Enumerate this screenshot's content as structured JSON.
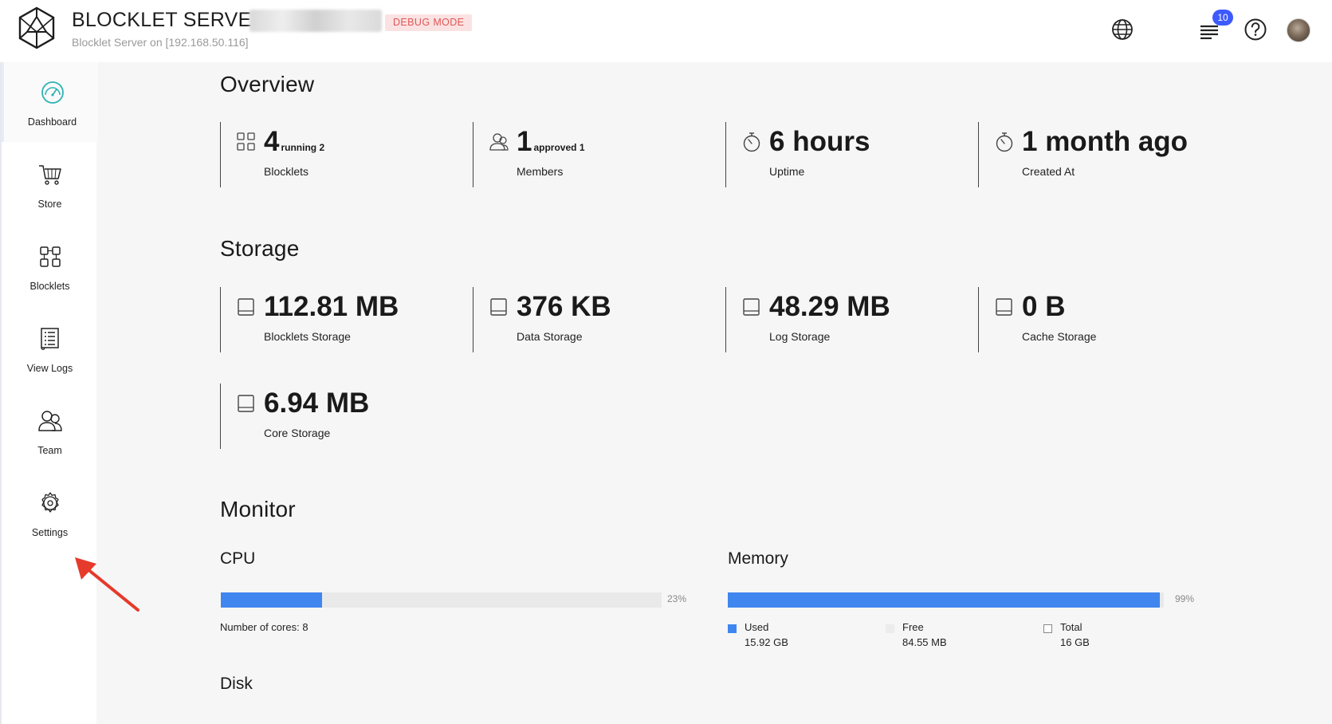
{
  "header": {
    "title": "BLOCKLET SERVER",
    "debug_badge": "DEBUG MODE",
    "subtitle": "Blocklet Server on [192.168.50.116]",
    "notification_count": "10",
    "icons": [
      "globe-icon",
      "notifications-icon",
      "help-icon",
      "avatar"
    ]
  },
  "sidebar": {
    "items": [
      {
        "label": "Dashboard",
        "icon": "dashboard-gauge-icon",
        "active": true
      },
      {
        "label": "Store",
        "icon": "store-cart-icon"
      },
      {
        "label": "Blocklets",
        "icon": "blocklets-grid-icon"
      },
      {
        "label": "View Logs",
        "icon": "logs-icon"
      },
      {
        "label": "Team",
        "icon": "team-icon"
      },
      {
        "label": "Settings",
        "icon": "gear-icon"
      }
    ]
  },
  "overview": {
    "title": "Overview",
    "stats": [
      {
        "value": "4",
        "sub": "running 2",
        "label": "Blocklets",
        "icon": "blocklets-grid-icon"
      },
      {
        "value": "1",
        "sub": "approved 1",
        "label": "Members",
        "icon": "members-icon"
      },
      {
        "value": "6 hours",
        "label": "Uptime",
        "icon": "stopwatch-icon"
      },
      {
        "value": "1 month ago",
        "label": "Created At",
        "icon": "stopwatch-icon"
      }
    ]
  },
  "storage": {
    "title": "Storage",
    "items": [
      {
        "value": "112.81 MB",
        "label": "Blocklets Storage",
        "icon": "drive-icon"
      },
      {
        "value": "376 KB",
        "label": "Data Storage",
        "icon": "drive-icon"
      },
      {
        "value": "48.29 MB",
        "label": "Log Storage",
        "icon": "drive-icon"
      },
      {
        "value": "0 B",
        "label": "Cache Storage",
        "icon": "drive-icon"
      },
      {
        "value": "6.94 MB",
        "label": "Core Storage",
        "icon": "drive-icon"
      }
    ]
  },
  "monitor": {
    "title": "Monitor",
    "cpu": {
      "title": "CPU",
      "percent_label": "23%",
      "percent": 0.23,
      "cores_text": "Number of cores: 8"
    },
    "memory": {
      "title": "Memory",
      "percent_label": "99%",
      "percent": 0.99,
      "legend": [
        {
          "label": "Used",
          "value": "15.92 GB",
          "color": "#3f86ee"
        },
        {
          "label": "Free",
          "value": "84.55 MB",
          "color": "#ececec"
        },
        {
          "label": "Total",
          "value": "16 GB",
          "color": "#ffffff"
        }
      ]
    },
    "disk": {
      "title": "Disk"
    }
  },
  "colors": {
    "accent_blue": "#3f86ee",
    "debug_red": "#e05656",
    "debug_bg": "#fbe2e2",
    "badge_blue": "#3d5afe",
    "pointer_red": "#e53a2c"
  }
}
